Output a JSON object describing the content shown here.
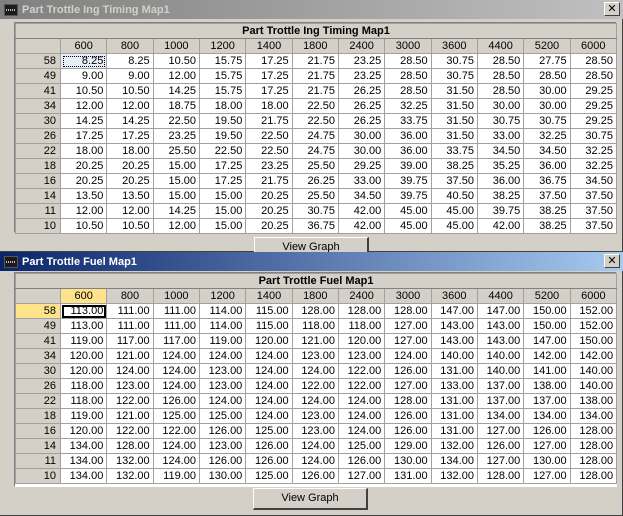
{
  "timing": {
    "window_title": "Part Trottle Ing Timing Map1",
    "table_title": "Part Trottle Ing Timing Map1",
    "button_label": "View Graph",
    "columns": [
      "600",
      "800",
      "1000",
      "1200",
      "1400",
      "1800",
      "2400",
      "3000",
      "3600",
      "4400",
      "5200",
      "6000"
    ],
    "rows": [
      {
        "label": "58",
        "values": [
          "8.25",
          "8.25",
          "10.50",
          "15.75",
          "17.25",
          "21.75",
          "23.25",
          "28.50",
          "30.75",
          "28.50",
          "27.75",
          "28.50"
        ]
      },
      {
        "label": "49",
        "values": [
          "9.00",
          "9.00",
          "12.00",
          "15.75",
          "17.25",
          "21.75",
          "23.25",
          "28.50",
          "30.75",
          "28.50",
          "28.50",
          "28.50"
        ]
      },
      {
        "label": "41",
        "values": [
          "10.50",
          "10.50",
          "14.25",
          "15.75",
          "17.25",
          "21.75",
          "26.25",
          "28.50",
          "31.50",
          "28.50",
          "30.00",
          "29.25"
        ]
      },
      {
        "label": "34",
        "values": [
          "12.00",
          "12.00",
          "18.75",
          "18.00",
          "18.00",
          "22.50",
          "26.25",
          "32.25",
          "31.50",
          "30.00",
          "30.00",
          "29.25"
        ]
      },
      {
        "label": "30",
        "values": [
          "14.25",
          "14.25",
          "22.50",
          "19.50",
          "21.75",
          "22.50",
          "26.25",
          "33.75",
          "31.50",
          "30.75",
          "30.75",
          "29.25"
        ]
      },
      {
        "label": "26",
        "values": [
          "17.25",
          "17.25",
          "23.25",
          "19.50",
          "22.50",
          "24.75",
          "30.00",
          "36.00",
          "31.50",
          "33.00",
          "32.25",
          "30.75"
        ]
      },
      {
        "label": "22",
        "values": [
          "18.00",
          "18.00",
          "25.50",
          "22.50",
          "22.50",
          "24.75",
          "30.00",
          "36.00",
          "33.75",
          "34.50",
          "34.50",
          "32.25"
        ]
      },
      {
        "label": "18",
        "values": [
          "20.25",
          "20.25",
          "15.00",
          "17.25",
          "23.25",
          "25.50",
          "29.25",
          "39.00",
          "38.25",
          "35.25",
          "36.00",
          "32.25"
        ]
      },
      {
        "label": "16",
        "values": [
          "20.25",
          "20.25",
          "15.00",
          "17.25",
          "21.75",
          "26.25",
          "33.00",
          "39.75",
          "37.50",
          "36.00",
          "36.75",
          "34.50"
        ]
      },
      {
        "label": "14",
        "values": [
          "13.50",
          "13.50",
          "15.00",
          "15.00",
          "20.25",
          "25.50",
          "34.50",
          "39.75",
          "40.50",
          "38.25",
          "37.50",
          "37.50"
        ]
      },
      {
        "label": "11",
        "values": [
          "12.00",
          "12.00",
          "14.25",
          "15.00",
          "20.25",
          "30.75",
          "42.00",
          "45.00",
          "45.00",
          "39.75",
          "38.25",
          "37.50"
        ]
      },
      {
        "label": "10",
        "values": [
          "10.50",
          "10.50",
          "12.00",
          "15.00",
          "20.25",
          "36.75",
          "42.00",
          "45.00",
          "45.00",
          "42.00",
          "38.25",
          "37.50"
        ]
      }
    ]
  },
  "fuel": {
    "window_title": "Part Trottle Fuel Map1",
    "table_title": "Part Trottle Fuel Map1",
    "button_label": "View Graph",
    "columns": [
      "600",
      "800",
      "1000",
      "1200",
      "1400",
      "1800",
      "2400",
      "3000",
      "3600",
      "4400",
      "5200",
      "6000"
    ],
    "rows": [
      {
        "label": "58",
        "values": [
          "113.00",
          "111.00",
          "111.00",
          "114.00",
          "115.00",
          "128.00",
          "128.00",
          "128.00",
          "147.00",
          "147.00",
          "150.00",
          "152.00"
        ]
      },
      {
        "label": "49",
        "values": [
          "113.00",
          "111.00",
          "111.00",
          "114.00",
          "115.00",
          "118.00",
          "118.00",
          "127.00",
          "143.00",
          "143.00",
          "150.00",
          "152.00"
        ]
      },
      {
        "label": "41",
        "values": [
          "119.00",
          "117.00",
          "117.00",
          "119.00",
          "120.00",
          "121.00",
          "120.00",
          "127.00",
          "143.00",
          "143.00",
          "147.00",
          "150.00"
        ]
      },
      {
        "label": "34",
        "values": [
          "120.00",
          "121.00",
          "124.00",
          "124.00",
          "124.00",
          "123.00",
          "123.00",
          "124.00",
          "140.00",
          "140.00",
          "142.00",
          "142.00"
        ]
      },
      {
        "label": "30",
        "values": [
          "120.00",
          "124.00",
          "124.00",
          "123.00",
          "124.00",
          "124.00",
          "122.00",
          "126.00",
          "131.00",
          "140.00",
          "141.00",
          "140.00"
        ]
      },
      {
        "label": "26",
        "values": [
          "118.00",
          "123.00",
          "124.00",
          "123.00",
          "124.00",
          "122.00",
          "122.00",
          "127.00",
          "133.00",
          "137.00",
          "138.00",
          "140.00"
        ]
      },
      {
        "label": "22",
        "values": [
          "118.00",
          "122.00",
          "126.00",
          "124.00",
          "124.00",
          "124.00",
          "124.00",
          "128.00",
          "131.00",
          "137.00",
          "137.00",
          "138.00"
        ]
      },
      {
        "label": "18",
        "values": [
          "119.00",
          "121.00",
          "125.00",
          "125.00",
          "124.00",
          "123.00",
          "124.00",
          "126.00",
          "131.00",
          "134.00",
          "134.00",
          "134.00"
        ]
      },
      {
        "label": "16",
        "values": [
          "120.00",
          "122.00",
          "122.00",
          "126.00",
          "125.00",
          "123.00",
          "124.00",
          "126.00",
          "131.00",
          "127.00",
          "126.00",
          "128.00"
        ]
      },
      {
        "label": "14",
        "values": [
          "134.00",
          "128.00",
          "124.00",
          "123.00",
          "126.00",
          "124.00",
          "125.00",
          "129.00",
          "132.00",
          "126.00",
          "127.00",
          "128.00"
        ]
      },
      {
        "label": "11",
        "values": [
          "134.00",
          "132.00",
          "124.00",
          "126.00",
          "126.00",
          "124.00",
          "126.00",
          "130.00",
          "134.00",
          "127.00",
          "130.00",
          "128.00"
        ]
      },
      {
        "label": "10",
        "values": [
          "134.00",
          "132.00",
          "119.00",
          "130.00",
          "125.00",
          "126.00",
          "127.00",
          "131.00",
          "132.00",
          "128.00",
          "127.00",
          "128.00"
        ]
      }
    ]
  },
  "close_glyph": "✕",
  "colors": {
    "active_title": "#0a246a",
    "selection_highlight": "#ffe38a"
  }
}
